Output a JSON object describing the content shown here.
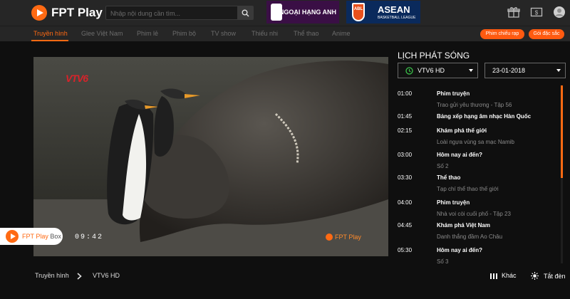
{
  "header": {
    "app_name": "FPT Play",
    "search_placeholder": "Nhập nội dung cần tìm...",
    "ads": [
      {
        "label": "NGOẠI HẠNG ANH"
      },
      {
        "badge": "ABL",
        "label": "ASEAN",
        "sublabel": "BASKETBALL LEAGUE"
      }
    ],
    "icons": [
      "gift-icon",
      "payment-icon",
      "user-avatar-icon"
    ]
  },
  "nav": {
    "items": [
      {
        "label": "Truyền hình",
        "active": true
      },
      {
        "label": "Glee Việt Nam"
      },
      {
        "label": "Phim lẻ"
      },
      {
        "label": "Phim bộ"
      },
      {
        "label": "TV show"
      },
      {
        "label": "Thiếu nhi"
      },
      {
        "label": "Thể thao"
      },
      {
        "label": "Anime"
      }
    ],
    "buttons": {
      "cinema": "Phim chiếu rạp",
      "package": "Gói đặc sắc"
    }
  },
  "player": {
    "channel_logo": "VTV6",
    "timecode": "09:42",
    "watermark": "FPT Play",
    "promo_badge_brand": "FPT Play",
    "promo_badge_suffix": "Box"
  },
  "schedule": {
    "title": "LỊCH PHÁT SÓNG",
    "channel_select": "VTV6 HD",
    "date_select": "23-01-2018",
    "items": [
      {
        "time": "01:00",
        "name": "Phim truyện",
        "sub": "Trao gửi yêu thương - Tập 56"
      },
      {
        "time": "01:45",
        "name": "Bảng xếp hạng âm nhạc Hàn Quốc",
        "sub": ""
      },
      {
        "time": "02:15",
        "name": "Khám phá thế giới",
        "sub": "Loài ngựa vùng sa mạc Namib"
      },
      {
        "time": "03:00",
        "name": "Hôm nay ai đến?",
        "sub": "Số 2"
      },
      {
        "time": "03:30",
        "name": "Thể thao",
        "sub": "Tạp chí thể thao thế giới"
      },
      {
        "time": "04:00",
        "name": "Phim truyện",
        "sub": "Nhà voi còi cuối phố - Tập 23"
      },
      {
        "time": "04:45",
        "name": "Khám phá Việt Nam",
        "sub": "Danh thắng đầm Ao Châu"
      },
      {
        "time": "05:30",
        "name": "Hôm nay ai đến?",
        "sub": "Số 3"
      }
    ]
  },
  "footer": {
    "breadcrumb_root": "Truyền hình",
    "breadcrumb_current": "VTV6 HD",
    "other_label": "Khác",
    "lights_label": "Tắt đèn"
  },
  "colors": {
    "accent": "#ff6a13",
    "bar": "#262626",
    "background": "#0f0f0f"
  }
}
